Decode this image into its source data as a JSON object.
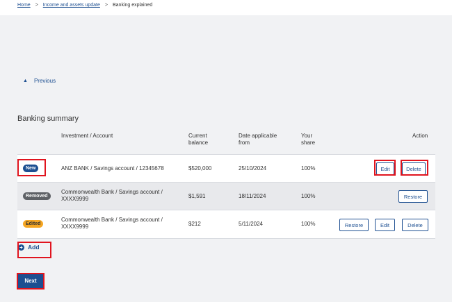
{
  "breadcrumb": {
    "items": [
      "Home",
      "Income and assets update",
      "Banking explained"
    ],
    "separator": ">"
  },
  "nav": {
    "previous_label": "Previous",
    "chevron": "▲"
  },
  "summary": {
    "title": "Banking summary",
    "headers": {
      "account": "Investment / Account",
      "balance": [
        "Current",
        "balance"
      ],
      "date": [
        "Date applicable",
        "from"
      ],
      "share": [
        "Your",
        "share"
      ],
      "action": "Action"
    },
    "rows": [
      {
        "badge": "New",
        "account": [
          "ANZ BANK / Savings account / 12345678"
        ],
        "balance": "$520,000",
        "date": "25/10/2024",
        "share": "100%",
        "actions": [
          "Edit",
          "Delete"
        ]
      },
      {
        "badge": "Removed",
        "account": [
          "Commonwealth Bank / Savings account /",
          "XXXX9999"
        ],
        "balance": "$1,591",
        "date": "18/11/2024",
        "share": "100%",
        "actions": [
          "Restore"
        ]
      },
      {
        "badge": "Edited",
        "account": [
          "Commonwealth Bank / Savings account /",
          "XXXX9999"
        ],
        "balance": "$212",
        "date": "5/11/2024",
        "share": "100%",
        "actions": [
          "Restore",
          "Edit",
          "Delete"
        ]
      }
    ]
  },
  "add_label": "Add",
  "next_label": "Next",
  "colors": {
    "primary": "#1d4f91",
    "highlight": "#e0141e",
    "edited": "#f5a623",
    "removed": "#5e6166"
  }
}
